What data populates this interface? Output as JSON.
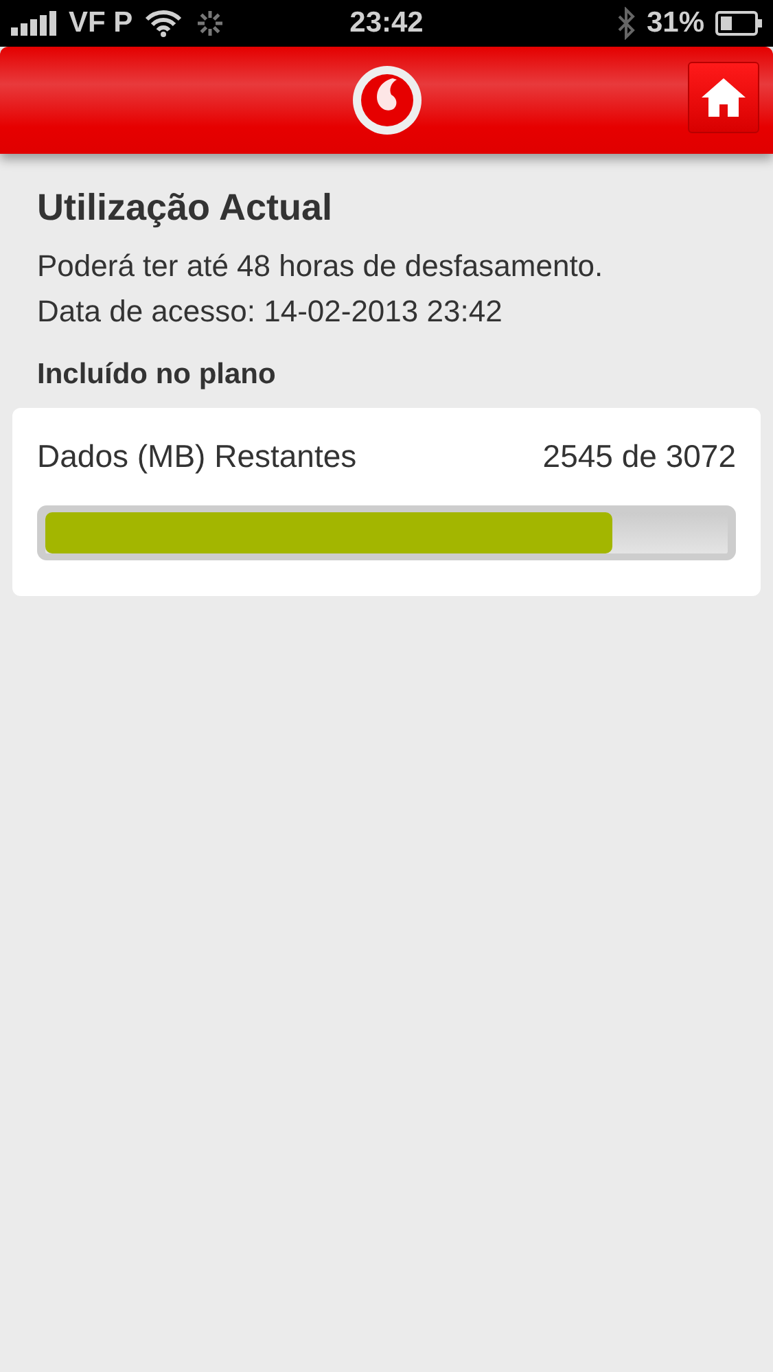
{
  "status_bar": {
    "carrier": "VF P",
    "time": "23:42",
    "battery": "31%"
  },
  "page": {
    "title": "Utilização Actual",
    "notice": "Poderá ter até 48 horas de desfasamento.",
    "access_date": "Data de acesso: 14-02-2013 23:42",
    "section": "Incluído no plano"
  },
  "usage": [
    {
      "label": "Dados (MB) Restantes",
      "reading": "2545 de 3072",
      "level": 0.83
    }
  ]
}
